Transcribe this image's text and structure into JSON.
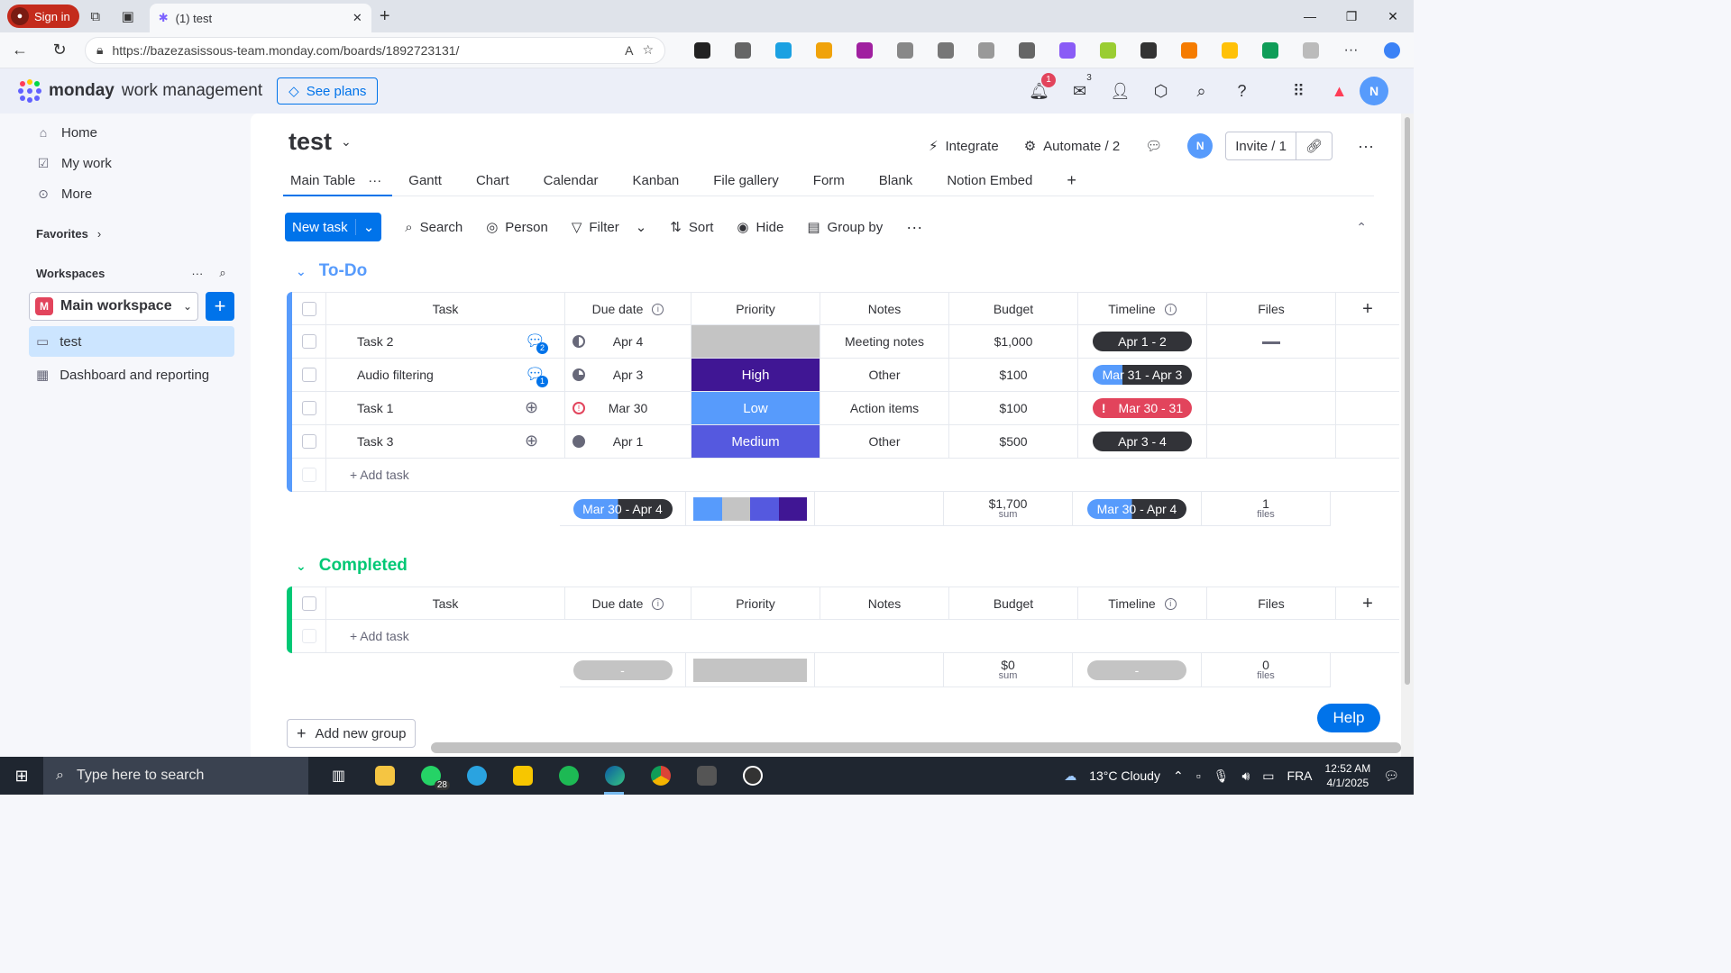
{
  "browser": {
    "signin_label": "Sign in",
    "tab_title": "(1) test",
    "url": "https://bazezasissous-team.monday.com/boards/1892723131/"
  },
  "header": {
    "brand_bold": "monday",
    "brand_rest": "work management",
    "see_plans": "See plans",
    "notif_count": "1",
    "inbox_count": "3",
    "avatar_initial": "N"
  },
  "sidebar": {
    "items": [
      {
        "label": "Home",
        "icon": "home-icon"
      },
      {
        "label": "My work",
        "icon": "calendar-check-icon"
      },
      {
        "label": "More",
        "icon": "more-icon"
      }
    ],
    "favorites_label": "Favorites",
    "workspaces_label": "Workspaces",
    "workspace": {
      "initial": "M",
      "name": "Main workspace"
    },
    "boards": [
      {
        "label": "test",
        "active": true
      },
      {
        "label": "Dashboard and reporting",
        "active": false
      }
    ]
  },
  "board": {
    "title": "test",
    "integrate": "Integrate",
    "automate": "Automate / 2",
    "invite": "Invite / 1",
    "avatar_initial": "N",
    "views": [
      "Main Table",
      "Gantt",
      "Chart",
      "Calendar",
      "Kanban",
      "File gallery",
      "Form",
      "Blank",
      "Notion Embed"
    ],
    "toolbar": {
      "new_task": "New task",
      "search": "Search",
      "person": "Person",
      "filter": "Filter",
      "sort": "Sort",
      "hide": "Hide",
      "group_by": "Group by"
    },
    "columns": [
      "Task",
      "Due date",
      "Priority",
      "Notes",
      "Budget",
      "Timeline",
      "Files"
    ],
    "add_task": "+ Add task",
    "add_group": "Add new group",
    "help": "Help"
  },
  "groups": [
    {
      "name": "To-Do",
      "color": "#579bfc",
      "rows": [
        {
          "task": "Task 2",
          "updates": "2",
          "due": "Apr 4",
          "priority": "",
          "priority_color": "#c4c4c4",
          "notes": "Meeting notes",
          "budget": "$1,000",
          "timeline": "Apr 1 - 2",
          "files": "file"
        },
        {
          "task": "Audio filtering",
          "updates": "1",
          "due": "Apr 3",
          "priority": "High",
          "priority_color": "#401694",
          "notes": "Other",
          "budget": "$100",
          "timeline": "Mar 31 - Apr 3",
          "files": ""
        },
        {
          "task": "Task 1",
          "updates": "",
          "due": "Mar 30",
          "priority": "Low",
          "priority_color": "#579bfc",
          "notes": "Action items",
          "budget": "$100",
          "timeline": "Mar 30 - 31",
          "files": ""
        },
        {
          "task": "Task 3",
          "updates": "",
          "due": "Apr 1",
          "priority": "Medium",
          "priority_color": "#5559df",
          "notes": "Other",
          "budget": "$500",
          "timeline": "Apr 3 - 4",
          "files": ""
        }
      ],
      "summary": {
        "due": "Mar 30 - Apr 4",
        "budget": "$1,700",
        "budget_unit": "sum",
        "timeline": "Mar 30 - Apr 4",
        "files": "1",
        "files_unit": "files"
      }
    },
    {
      "name": "Completed",
      "color": "#00c875",
      "rows": [],
      "summary": {
        "due": "-",
        "budget": "$0",
        "budget_unit": "sum",
        "timeline": "-",
        "files": "0",
        "files_unit": "files"
      }
    }
  ],
  "taskbar": {
    "search_placeholder": "Type here to search",
    "whatsapp_count": "28",
    "weather": "13°C  Cloudy",
    "lang": "FRA",
    "time": "12:52 AM",
    "date": "4/1/2025"
  }
}
